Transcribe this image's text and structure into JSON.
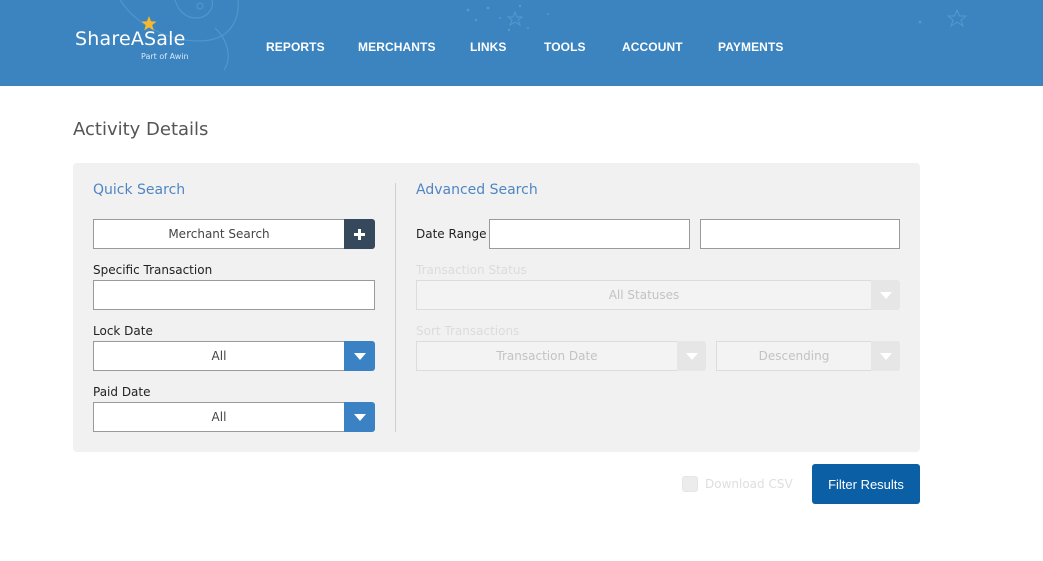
{
  "brand": {
    "name": "ShareASale",
    "subtitle": "Part of Awin",
    "header_color": "#3b84c0"
  },
  "nav": {
    "items": [
      {
        "label": "REPORTS"
      },
      {
        "label": "MERCHANTS"
      },
      {
        "label": "LINKS"
      },
      {
        "label": "TOOLS"
      },
      {
        "label": "ACCOUNT"
      },
      {
        "label": "PAYMENTS"
      }
    ]
  },
  "page": {
    "title": "Activity Details"
  },
  "quick_search": {
    "title": "Quick Search",
    "merchant_search": {
      "value": "Merchant Search",
      "add_icon": "plus-icon"
    },
    "specific_transaction": {
      "label": "Specific Transaction",
      "value": ""
    },
    "lock_date": {
      "label": "Lock Date",
      "selected": "All",
      "icon": "caret-down-icon"
    },
    "paid_date": {
      "label": "Paid Date",
      "selected": "All",
      "icon": "caret-down-icon"
    }
  },
  "advanced_search": {
    "title": "Advanced Search",
    "date_range": {
      "label": "Date Range",
      "start": "",
      "end": ""
    },
    "transaction_status": {
      "label": "Transaction Status",
      "selected": "All Statuses"
    },
    "sort_transactions": {
      "label": "Sort Transactions",
      "field": "Transaction Date",
      "order": "Descending"
    }
  },
  "actions": {
    "download_csv": {
      "label": "Download CSV",
      "checked": false
    },
    "filter_button": "Filter Results"
  },
  "colors": {
    "accent": "#3a82c4",
    "primary_button": "#0a5fa5",
    "section_title": "#4f86c2"
  }
}
